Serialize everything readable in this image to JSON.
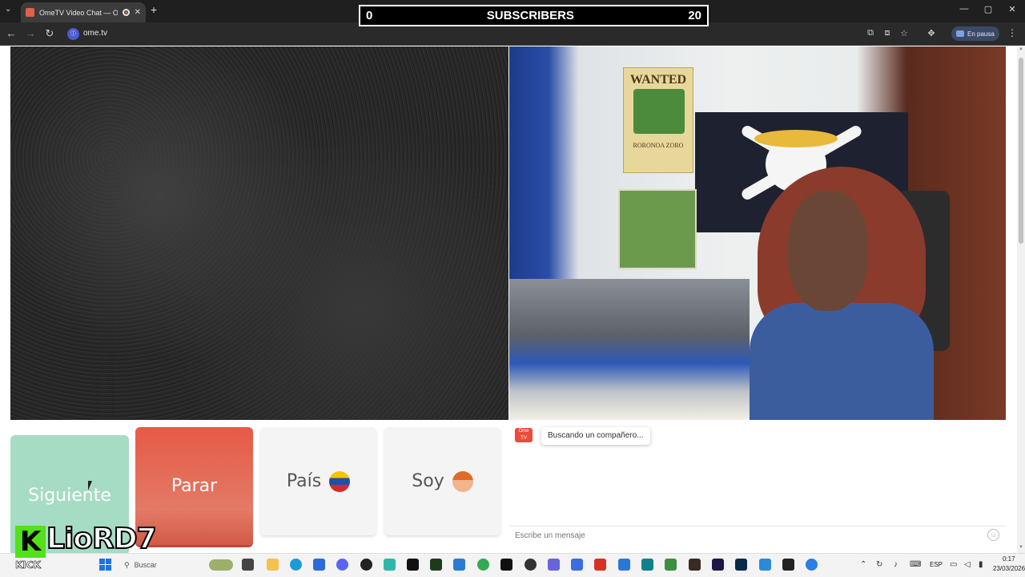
{
  "browser": {
    "tab_title": "OmeTV Video Chat — Ome",
    "tab_close": "✕",
    "tab_list": "⌄",
    "new_tab": "+",
    "url": "ome.tv",
    "back_icon": "←",
    "forward_icon": "→",
    "reload_icon": "↻",
    "profile_label": "En pausa",
    "window": {
      "minimize": "—",
      "maximize": "▢",
      "close": "✕"
    },
    "menu_icon": "⋮"
  },
  "overlay": {
    "subscribers_current": "0",
    "subscribers_label": "SUBSCRIBERS",
    "subscribers_goal": "20",
    "kick_logo": "K",
    "kick_name": "LioRD7",
    "kick_label": "KICK"
  },
  "room": {
    "wanted_title": "WANTED",
    "wanted_name": "RORONOA ZORO"
  },
  "controls": {
    "next_label": "Siguiente",
    "stop_label": "Parar",
    "country_label": "País",
    "gender_label": "Soy",
    "country_flag": "venezuela-flag",
    "gender_icon": "boy-emoji"
  },
  "chat": {
    "logo_text": "Ome TV",
    "status": "Buscando un compañero...",
    "input_placeholder": "Escribe un mensaje",
    "emoji_icon": "☺"
  },
  "taskbar": {
    "search_label": "Buscar",
    "language": "ESP",
    "time": "0:17",
    "date": "23/03/2026",
    "colors": {
      "accent": "#1a73e8"
    }
  },
  "colors": {
    "next_button": "#a6dcc4",
    "stop_button": "#e65a45",
    "kick_green": "#52e11a"
  }
}
